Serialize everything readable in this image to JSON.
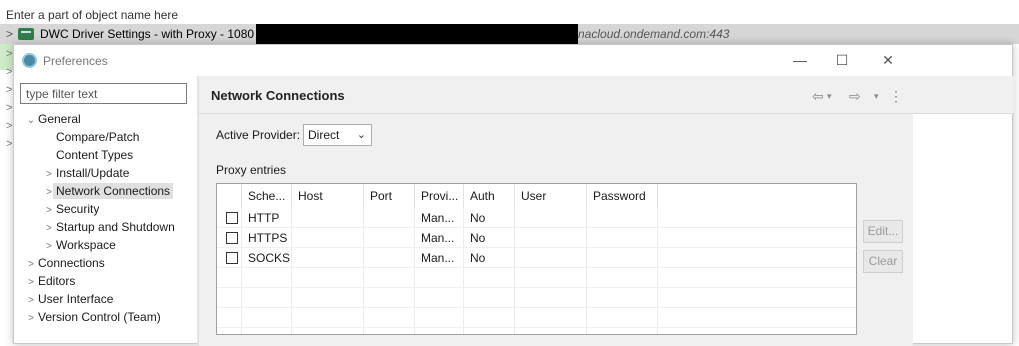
{
  "background": {
    "filter_placeholder": "Enter a part of object name here",
    "connection_label": "DWC Driver Settings - with Proxy - 1080",
    "connection_host": "nacloud.ondemand.com:443",
    "chevron": ">"
  },
  "dialog": {
    "title": "Preferences",
    "minimize": "—",
    "maximize": "☐",
    "close": "✕"
  },
  "left": {
    "filter_placeholder": "type filter text",
    "tree": [
      {
        "label": "General",
        "twisty": "⌄"
      },
      {
        "label": "Compare/Patch",
        "twisty": ""
      },
      {
        "label": "Content Types",
        "twisty": ""
      },
      {
        "label": "Install/Update",
        "twisty": ">"
      },
      {
        "label": "Network Connections",
        "twisty": ">"
      },
      {
        "label": "Security",
        "twisty": ">"
      },
      {
        "label": "Startup and Shutdown",
        "twisty": ">"
      },
      {
        "label": "Workspace",
        "twisty": ">"
      },
      {
        "label": "Connections",
        "twisty": ">"
      },
      {
        "label": "Editors",
        "twisty": ">"
      },
      {
        "label": "User Interface",
        "twisty": ">"
      },
      {
        "label": "Version Control (Team)",
        "twisty": ">"
      }
    ]
  },
  "page": {
    "title": "Network Connections",
    "back": "⇦",
    "forward": "⇨",
    "dropdown": "▾",
    "menu": "⋮",
    "active_provider_label": "Active Provider:",
    "active_provider_value": "Direct",
    "select_arrow": "⌄",
    "proxy_entries_label": "Proxy entries",
    "columns": [
      "Sche...",
      "Host",
      "Port",
      "Provi...",
      "Auth",
      "User",
      "Password"
    ],
    "rows": [
      {
        "scheme": "HTTP",
        "host": "",
        "port": "",
        "provider": "Man...",
        "auth": "No",
        "user": "",
        "password": ""
      },
      {
        "scheme": "HTTPS",
        "host": "",
        "port": "",
        "provider": "Man...",
        "auth": "No",
        "user": "",
        "password": ""
      },
      {
        "scheme": "SOCKS",
        "host": "",
        "port": "",
        "provider": "Man...",
        "auth": "No",
        "user": "",
        "password": ""
      }
    ],
    "edit_button": "Edit...",
    "clear_button": "Clear"
  }
}
